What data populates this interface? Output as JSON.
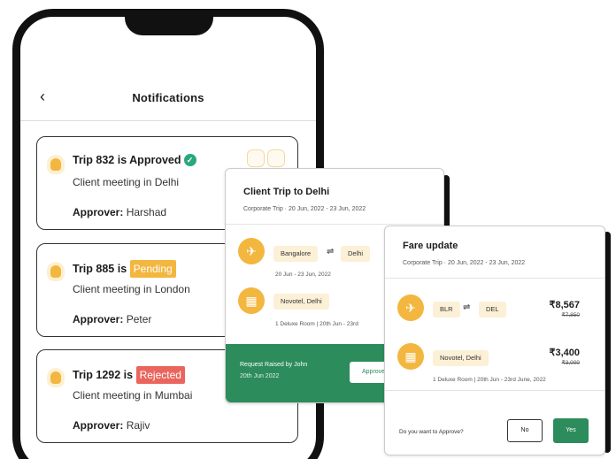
{
  "phone": {
    "back_glyph": "‹",
    "title": "Notifications",
    "notifications": [
      {
        "title": "Trip 832 is Approved",
        "status": "",
        "subtitle": "Client meeting in Delhi",
        "approver_label": "Approver:",
        "approver": "Harshad",
        "status_icon": "check-circle-icon"
      },
      {
        "title": "Trip 885 is",
        "status": "Pending",
        "subtitle": "Client meeting in London",
        "approver_label": "Approver:",
        "approver": "Peter"
      },
      {
        "title": "Trip 1292 is",
        "status": "Rejected",
        "subtitle": "Client meeting in Mumbai",
        "approver_label": "Approver:",
        "approver": "Rajiv"
      }
    ]
  },
  "trip_card": {
    "title": "Client Trip to Delhi",
    "subtitle": "Corporate Trip · 20 Jun, 2022 - 23 Jun, 2022",
    "from": "Bangalore",
    "to": "Delhi",
    "flight_dates": "20 Jun - 23 Jun, 2022",
    "hotel": "Novotel, Delhi",
    "hotel_details": "1 Deluxe Room | 20th Jun - 23rd",
    "footer_line1": "Request Raised by John",
    "footer_line2": "20th Jun 2022",
    "footer_button": "Approve"
  },
  "fare_card": {
    "title": "Fare update",
    "subtitle": "Corporate Trip · 20 Jun, 2022 - 23 Jun, 2022",
    "from": "BLR",
    "to": "DEL",
    "flight_price": "₹8,567",
    "flight_old_price": "₹7,850",
    "hotel": "Novotel, Delhi",
    "hotel_price": "₹3,400",
    "hotel_old_price": "₹3,000",
    "hotel_details": "1 Deluxe Room | 20th Jun - 23rd June, 2022",
    "question": "Do you want to Approve?",
    "no_label": "No",
    "yes_label": "Yes"
  },
  "colors": {
    "accent_yellow": "#f3b63f",
    "green": "#2d8c5b",
    "rejected_red": "#e9655e",
    "approved_check": "#2aa87a"
  }
}
